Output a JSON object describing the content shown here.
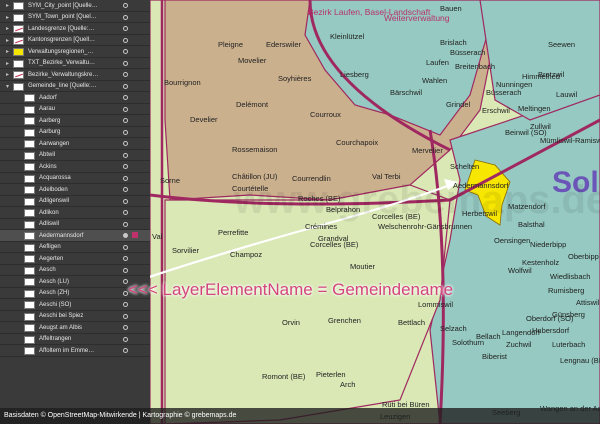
{
  "layer_panel": {
    "rows": [
      {
        "label": "SYM_City_point [Quelle…",
        "visible": true
      },
      {
        "label": "SYM_Town_point [Quel…",
        "visible": true
      },
      {
        "label": "Landesgrenze [Quelle:…",
        "visible": true
      },
      {
        "label": "Kantonsgrenzen [Quell…",
        "visible": true
      },
      {
        "label": "Verwaltungsregionen_…",
        "visible": true
      },
      {
        "label": "TXT_Bezirke_Verwaltu…",
        "visible": true
      },
      {
        "label": "Bezirke_Verwaltungskre…",
        "visible": true
      },
      {
        "label": "Gemeinde_line [Quelle:…",
        "visible": true
      },
      {
        "label": "Aadorf",
        "visible": true
      },
      {
        "label": "Aarau",
        "visible": true
      },
      {
        "label": "Aarberg",
        "visible": true
      },
      {
        "label": "Aarburg",
        "visible": true
      },
      {
        "label": "Aarwangen",
        "visible": true
      },
      {
        "label": "Abtwil",
        "visible": true
      },
      {
        "label": "Ackins",
        "visible": true
      },
      {
        "label": "Acquarossa",
        "visible": true
      },
      {
        "label": "Adelboden",
        "visible": true
      },
      {
        "label": "Adligenswil",
        "visible": true
      },
      {
        "label": "Adlikon",
        "visible": true
      },
      {
        "label": "Adliswil",
        "visible": true
      },
      {
        "label": "Aedermannsdorf",
        "visible": true
      },
      {
        "label": "Aefligen",
        "visible": true
      },
      {
        "label": "Aegerten",
        "visible": true
      },
      {
        "label": "Aesch",
        "visible": true
      },
      {
        "label": "Aesch (LU)",
        "visible": true
      },
      {
        "label": "Aesch (ZH)",
        "visible": true
      },
      {
        "label": "Aeschi (SO)",
        "visible": true
      },
      {
        "label": "Aeschi bei Spiez",
        "visible": true
      },
      {
        "label": "Aeugst am Albis",
        "visible": true
      },
      {
        "label": "Affeltrangen",
        "visible": true
      },
      {
        "label": "Affoltern im Emme…",
        "visible": true
      }
    ]
  },
  "map": {
    "places": [
      {
        "name": "Bauen",
        "region": false
      },
      {
        "name": "Kleinlützel",
        "region": false
      },
      {
        "name": "Pleigne",
        "region": false
      },
      {
        "name": "Ederswiler",
        "region": false
      },
      {
        "name": "Movelier",
        "region": false
      },
      {
        "name": "Bourrignon",
        "region": false
      },
      {
        "name": "Soyhières",
        "region": false
      },
      {
        "name": "Liesberg",
        "region": false
      },
      {
        "name": "Delémont",
        "region": false
      },
      {
        "name": "Courroux",
        "region": false
      },
      {
        "name": "Develier",
        "region": false
      },
      {
        "name": "Courchapoix",
        "region": false
      },
      {
        "name": "Rossemaison",
        "region": false
      },
      {
        "name": "Mervelier",
        "region": false
      },
      {
        "name": "Châtillon (JU)",
        "region": false
      },
      {
        "name": "Courrendlin",
        "region": false
      },
      {
        "name": "Val Terbi",
        "region": false
      },
      {
        "name": "Courtételle",
        "region": false
      },
      {
        "name": "Roches (BE)",
        "region": false
      },
      {
        "name": "Belprahon",
        "region": false
      },
      {
        "name": "Corcelles (BE)",
        "region": false
      },
      {
        "name": "Crémines",
        "region": false
      },
      {
        "name": "Grandval",
        "region": false
      },
      {
        "name": "Welschenrohr-Gänsbrunnen",
        "region": false
      },
      {
        "name": "Schelten",
        "region": false
      },
      {
        "name": "Aedermannsdorf",
        "region": false
      },
      {
        "name": "Herbetswil",
        "region": false
      },
      {
        "name": "Matzendorf",
        "region": false
      },
      {
        "name": "Beinwil (SO)",
        "region": false
      },
      {
        "name": "Erschwil",
        "region": false
      },
      {
        "name": "Grindel",
        "region": false
      },
      {
        "name": "Bärschwil",
        "region": false
      },
      {
        "name": "Wahlen",
        "region": false
      },
      {
        "name": "Breitenbach",
        "region": false
      },
      {
        "name": "Büsserach",
        "region": false
      },
      {
        "name": "Laufen",
        "region": false
      },
      {
        "name": "Brislach",
        "region": false
      },
      {
        "name": "Himmelried",
        "region": false
      },
      {
        "name": "Meltingen",
        "region": false
      },
      {
        "name": "Zullwil",
        "region": false
      },
      {
        "name": "Büsserach",
        "region": false
      },
      {
        "name": "Nunningen",
        "region": false
      },
      {
        "name": "Bretzwil",
        "region": false
      },
      {
        "name": "Lauwil",
        "region": false
      },
      {
        "name": "Seewen",
        "region": false
      },
      {
        "name": "Mümliswil-Ramiswil",
        "region": false
      },
      {
        "name": "Balsthal",
        "region": false
      },
      {
        "name": "Niederbipp",
        "region": false
      },
      {
        "name": "Oberbipp",
        "region": false
      },
      {
        "name": "Wiedlisbach",
        "region": false
      },
      {
        "name": "Rumisberg",
        "region": false
      },
      {
        "name": "Attiswil",
        "region": false
      },
      {
        "name": "Günsberg",
        "region": false
      },
      {
        "name": "Hubersdorf",
        "region": false
      },
      {
        "name": "Langendorf",
        "region": false
      },
      {
        "name": "Oberdorf (SO)",
        "region": false
      },
      {
        "name": "Bellach",
        "region": false
      },
      {
        "name": "Selzach",
        "region": false
      },
      {
        "name": "Bettlach",
        "region": false
      },
      {
        "name": "Grenchen",
        "region": false
      },
      {
        "name": "Lommiswil",
        "region": false
      },
      {
        "name": "Solothurn",
        "region": false
      },
      {
        "name": "Biberist",
        "region": false
      },
      {
        "name": "Zuchwil",
        "region": false
      },
      {
        "name": "Luterbach",
        "region": false
      },
      {
        "name": "Lengnau (BE)",
        "region": false
      },
      {
        "name": "Pieterlen",
        "region": false
      },
      {
        "name": "Romont (BE)",
        "region": false
      },
      {
        "name": "Orvin",
        "region": false
      },
      {
        "name": "Arch",
        "region": false
      },
      {
        "name": "Rüti bei Büren",
        "region": false
      },
      {
        "name": "Leuzigen",
        "region": false
      },
      {
        "name": "Seeberg",
        "region": false
      },
      {
        "name": "Oensingen",
        "region": false
      },
      {
        "name": "Kestenholz",
        "region": false
      },
      {
        "name": "Wolfwil",
        "region": false
      },
      {
        "name": "Wangen an der Aare",
        "region": false
      },
      {
        "name": "Champoz",
        "region": false
      },
      {
        "name": "Perrefitte",
        "region": false
      },
      {
        "name": "Sorvilier",
        "region": false
      },
      {
        "name": "Corcelles (BE)",
        "region": false
      },
      {
        "name": "Moutier",
        "region": false
      },
      {
        "name": "Val",
        "region": false
      },
      {
        "name": "Sorne",
        "region": false
      },
      {
        "name": "Bezirk Laufen, Basel-Landschaft",
        "region": true
      },
      {
        "name": "Weiterverwaltung",
        "region": true
      },
      {
        "name": "Solo",
        "region": false
      }
    ]
  },
  "annotation": {
    "text": "<<< LayerElementName = Gemeindename"
  },
  "watermark": {
    "text": "www.grebemaps.de"
  },
  "footer": {
    "text": "Basisdaten © OpenStreetMap-Mitwirkende | Kartographie © grebemaps.de"
  },
  "colors": {
    "panel_bg": "#3a3a3a",
    "map_tan": "#cbb08e",
    "map_green": "#d9e8b5",
    "map_teal": "#95c9c1",
    "selected_municipality": "#f7e600",
    "canton_border": "#a02860",
    "annotation": "#d4457e",
    "panel_marker": "#c0306b"
  }
}
